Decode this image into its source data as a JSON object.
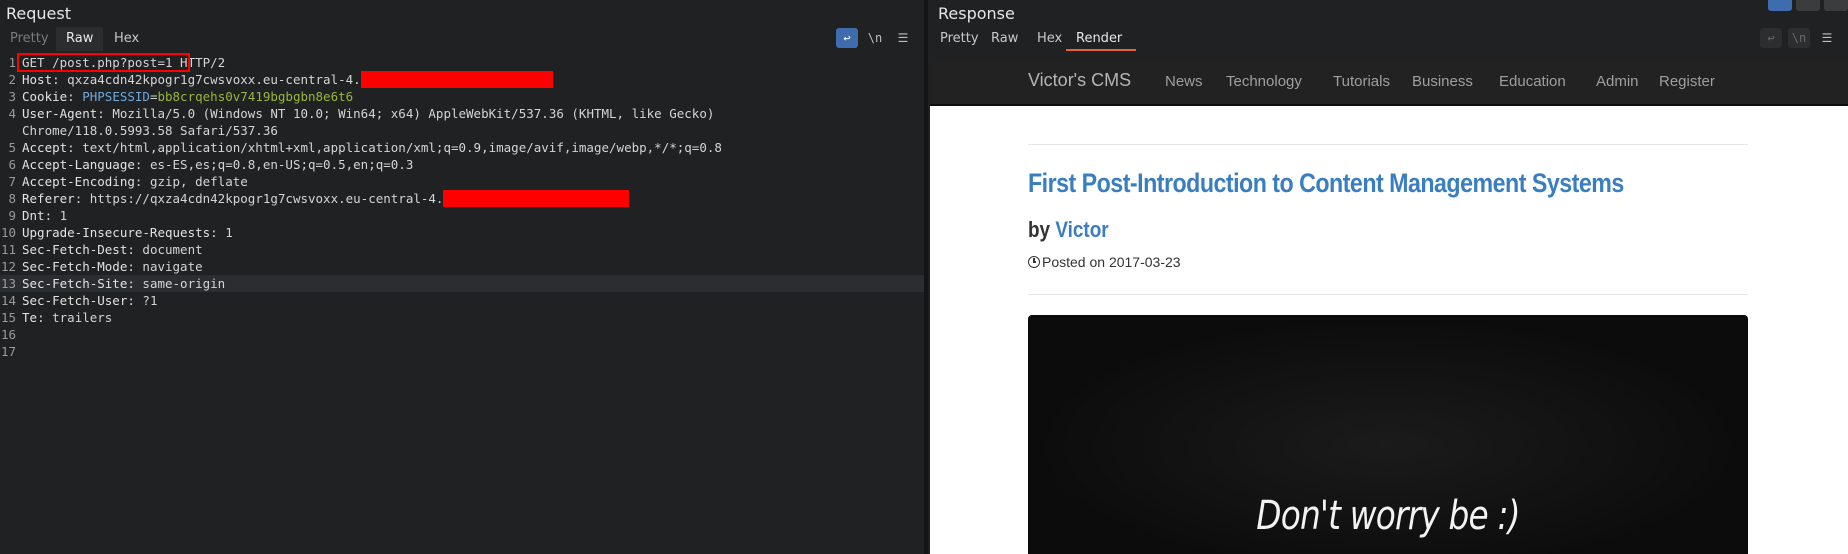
{
  "request": {
    "title": "Request",
    "tabs": [
      "Pretty",
      "Raw",
      "Hex"
    ],
    "active_tab": "Raw",
    "icons": [
      "wrap-lines-icon",
      "newline-icon",
      "menu-icon"
    ],
    "newline_glyph": "\\n",
    "lines": [
      {
        "n": "1",
        "text": "GET /post.php?post=1 HTTP/2"
      },
      {
        "n": "2",
        "name": "Host",
        "value": "qxza4cdn42kpogr1g7cwsvoxx.eu-central-4."
      },
      {
        "n": "3",
        "name": "Cookie",
        "key": "PHPSESSID",
        "eq": "=",
        "session": "bb8crqehs0v7419bgbgbn8e6t6"
      },
      {
        "n": "4",
        "name": "User-Agent",
        "value": "Mozilla/5.0 (Windows NT 10.0; Win64; x64) AppleWebKit/537.36 (KHTML, like Gecko)"
      },
      {
        "n": "",
        "text": "Chrome/118.0.5993.58 Safari/537.36"
      },
      {
        "n": "5",
        "name": "Accept",
        "value": "text/html,application/xhtml+xml,application/xml;q=0.9,image/avif,image/webp,*/*;q=0.8"
      },
      {
        "n": "6",
        "name": "Accept-Language",
        "value": "es-ES,es;q=0.8,en-US;q=0.5,en;q=0.3"
      },
      {
        "n": "7",
        "name": "Accept-Encoding",
        "value": "gzip, deflate"
      },
      {
        "n": "8",
        "name": "Referer",
        "value": "https://qxza4cdn42kpogr1g7cwsvoxx.eu-central-4."
      },
      {
        "n": "9",
        "name": "Dnt",
        "value": "1"
      },
      {
        "n": "10",
        "name": "Upgrade-Insecure-Requests",
        "value": "1"
      },
      {
        "n": "11",
        "name": "Sec-Fetch-Dest",
        "value": "document"
      },
      {
        "n": "12",
        "name": "Sec-Fetch-Mode",
        "value": "navigate"
      },
      {
        "n": "13",
        "name": "Sec-Fetch-Site",
        "value": "same-origin"
      },
      {
        "n": "14",
        "name": "Sec-Fetch-User",
        "value": "?1"
      },
      {
        "n": "15",
        "name": "Te",
        "value": "trailers"
      },
      {
        "n": "16",
        "text": ""
      },
      {
        "n": "17",
        "text": ""
      }
    ],
    "colon": ": ",
    "redaction_color": "#ff0000"
  },
  "response": {
    "title": "Response",
    "tabs": [
      "Pretty",
      "Raw",
      "Hex",
      "Render"
    ],
    "active_tab": "Render",
    "render": {
      "brand": "Victor's CMS",
      "nav": [
        "News",
        "Technology",
        "Tutorials",
        "Business",
        "Education",
        "Admin",
        "Register"
      ],
      "post_title": "First Post-Introduction to Content Management Systems",
      "by_label": "by",
      "author": "Victor",
      "posted_on": "Posted on 2017-03-23",
      "image_caption": "Don't worry be :)"
    }
  },
  "colors": {
    "accent_tab": "#e8622c",
    "link_blue": "#3a7ec2",
    "session_green": "#96b83a"
  }
}
